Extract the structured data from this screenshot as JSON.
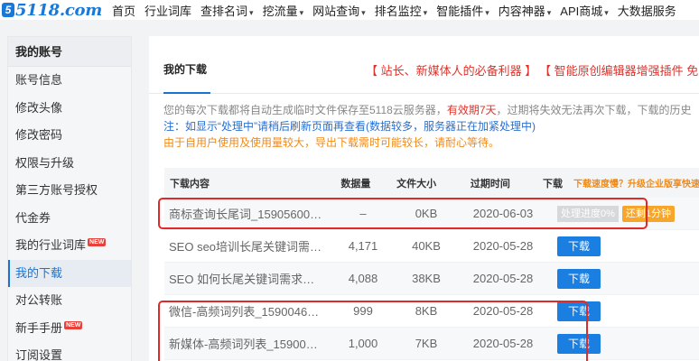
{
  "logo": {
    "mark": "5",
    "text": "5118.com"
  },
  "nav": [
    {
      "label": "首页",
      "caret": false
    },
    {
      "label": "行业词库",
      "caret": false
    },
    {
      "label": "查排名词",
      "caret": true
    },
    {
      "label": "挖流量",
      "caret": true
    },
    {
      "label": "网站查询",
      "caret": true
    },
    {
      "label": "排名监控",
      "caret": true
    },
    {
      "label": "智能插件",
      "caret": true
    },
    {
      "label": "内容神器",
      "caret": true
    },
    {
      "label": "API商城",
      "caret": true
    },
    {
      "label": "大数据服务",
      "caret": false
    }
  ],
  "sidebar": {
    "title": "我的账号",
    "items": [
      {
        "label": "账号信息",
        "badge": ""
      },
      {
        "label": "修改头像",
        "badge": ""
      },
      {
        "label": "修改密码",
        "badge": ""
      },
      {
        "label": "权限与升级",
        "badge": ""
      },
      {
        "label": "第三方账号授权",
        "badge": ""
      },
      {
        "label": "代金券",
        "badge": ""
      },
      {
        "label": "我的行业词库",
        "badge": "NEW"
      },
      {
        "label": "我的下载",
        "badge": "",
        "active": true
      },
      {
        "label": "对公转账",
        "badge": ""
      },
      {
        "label": "新手手册",
        "badge": "NEW"
      },
      {
        "label": "订阅设置",
        "badge": ""
      }
    ]
  },
  "tabs": {
    "my_downloads": "我的下载",
    "promo1": "【 站长、新媒体人的必备利器 】",
    "promo2": "【 智能原创编辑器增强插件 免费"
  },
  "notice": {
    "line1_a": "您的每次下载都将自动生成临时文件保存至5118云服务器，",
    "line1_red": "有效期7天",
    "line1_b": "，过期将失效无法再次下载，下载的历史",
    "line2": "注：如显示“处理中”请稍后刷新页面再查看(数据较多，服务器正在加紧处理中)",
    "line3": "由于自用户使用及使用量较大，导出下载需时可能较长，请耐心等待。"
  },
  "table": {
    "headers": {
      "name": "下载内容",
      "count": "数据量",
      "size": "文件大小",
      "expire": "过期时间",
      "action": "下载",
      "action_hint": "下载速度慢？升级企业版享快速下"
    },
    "download_label": "下载",
    "rows": [
      {
        "name": "商标查询长尾词_15905600…",
        "count": "–",
        "size": "0KB",
        "expire": "2020-06-03",
        "status": "processing",
        "progress": "处理进度0%",
        "remain": "还剩1分钟"
      },
      {
        "name": "SEO seo培训长尾关键词需…",
        "count": "4,171",
        "size": "40KB",
        "expire": "2020-05-28",
        "status": "ready"
      },
      {
        "name": "SEO 如何长尾关键词需求…",
        "count": "4,088",
        "size": "38KB",
        "expire": "2020-05-28",
        "status": "ready"
      },
      {
        "name": "微信-高频词列表_1590046…",
        "count": "999",
        "size": "8KB",
        "expire": "2020-05-28",
        "status": "ready"
      },
      {
        "name": "新媒体-高频词列表_15900…",
        "count": "1,000",
        "size": "7KB",
        "expire": "2020-05-28",
        "status": "ready"
      }
    ]
  },
  "colors": {
    "brand": "#1a79d8",
    "accent_red": "#e0322b",
    "orange": "#f08a16",
    "highlight_box": "#e02a2a"
  }
}
